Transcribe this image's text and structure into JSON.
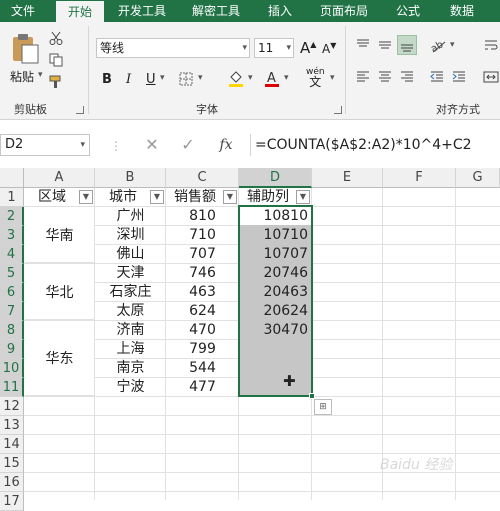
{
  "ribbon": {
    "tabs": [
      "文件",
      "开始",
      "开发工具",
      "解密工具",
      "插入",
      "页面布局",
      "公式",
      "数据"
    ],
    "active_tab": "开始",
    "clipboard": {
      "paste_label": "粘贴",
      "group_label": "剪贴板"
    },
    "font": {
      "name": "等线",
      "size": "11",
      "bold": "B",
      "italic": "I",
      "underline": "U",
      "phonetic": "wén",
      "group_label": "字体",
      "increase": "A",
      "decrease": "A"
    },
    "alignment": {
      "group_label": "对齐方式"
    }
  },
  "formula_bar": {
    "name_box": "D2",
    "cancel": "✕",
    "enter": "✓",
    "fx": "fx",
    "formula": "=COUNTA($A$2:A2)*10^4+C2"
  },
  "sheet": {
    "columns": [
      "A",
      "B",
      "C",
      "D",
      "E",
      "F",
      "G"
    ],
    "selected_column": "D",
    "rows": [
      "1",
      "2",
      "3",
      "4",
      "5",
      "6",
      "7",
      "8",
      "9",
      "10",
      "11",
      "12",
      "13",
      "14",
      "15",
      "16",
      "17"
    ],
    "headers": {
      "A": "区域",
      "B": "城市",
      "C": "销售额",
      "D": "辅助列"
    },
    "regions": [
      "华南",
      "华北",
      "华东"
    ],
    "data": [
      {
        "city": "广州",
        "sales": "810",
        "helper": "10810"
      },
      {
        "city": "深圳",
        "sales": "710",
        "helper": "10710"
      },
      {
        "city": "佛山",
        "sales": "707",
        "helper": "10707"
      },
      {
        "city": "天津",
        "sales": "746",
        "helper": "20746"
      },
      {
        "city": "石家庄",
        "sales": "463",
        "helper": "20463"
      },
      {
        "city": "太原",
        "sales": "624",
        "helper": "20624"
      },
      {
        "city": "济南",
        "sales": "470",
        "helper": "30470"
      },
      {
        "city": "上海",
        "sales": "799",
        "helper": ""
      },
      {
        "city": "南京",
        "sales": "544",
        "helper": ""
      },
      {
        "city": "宁波",
        "sales": "477",
        "helper": ""
      }
    ]
  },
  "watermark": "Baidu 经验"
}
